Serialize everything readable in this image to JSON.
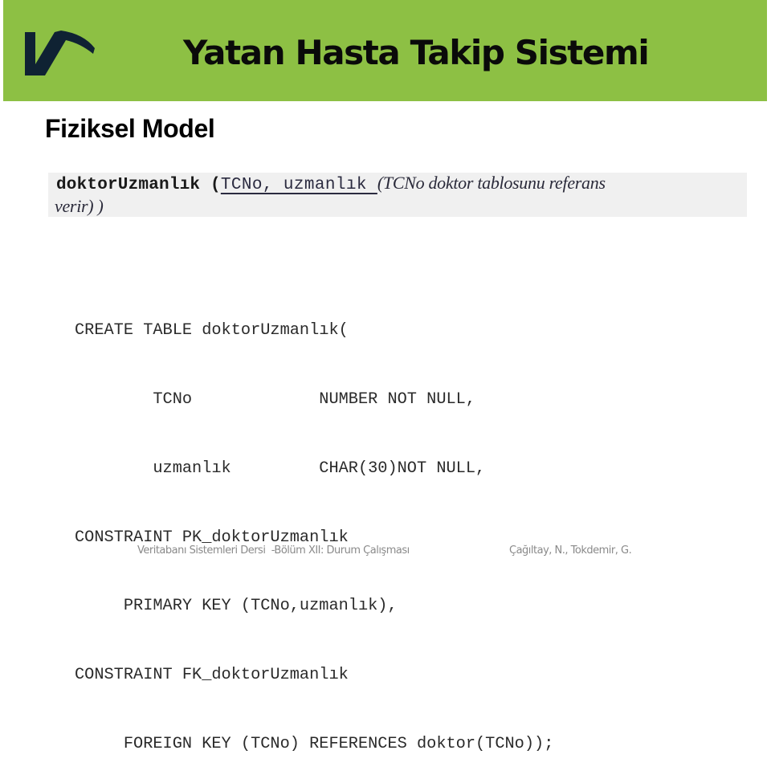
{
  "header": {
    "title": "Yatan Hasta Takip Sistemi",
    "logo_icon": "vt-logo-icon",
    "band_color": "#8dc044"
  },
  "subtitle": "Fiziksel Model",
  "schema": {
    "table_name": "doktorUzmanlık (",
    "keys": "TCNo, uzmanlık ",
    "note": "(TCNo doktor tablosunu referans",
    "note_cont": "verir) )"
  },
  "sql": {
    "lines": [
      "CREATE TABLE doktorUzmanlık(",
      "        TCNo             NUMBER NOT NULL,",
      "        uzmanlık         CHAR(30)NOT NULL,",
      "CONSTRAINT PK_doktorUzmanlık",
      "     PRIMARY KEY (TCNo,uzmanlık),",
      "CONSTRAINT FK_doktorUzmanlık",
      "     FOREIGN KEY (TCNo) REFERENCES doktor(TCNo));"
    ]
  },
  "footer": {
    "course": "Veritabanı Sistemleri Dersi  -Bölüm XII: Durum Çalışması",
    "authors": "Çağıltay, N., Tokdemir, G."
  }
}
